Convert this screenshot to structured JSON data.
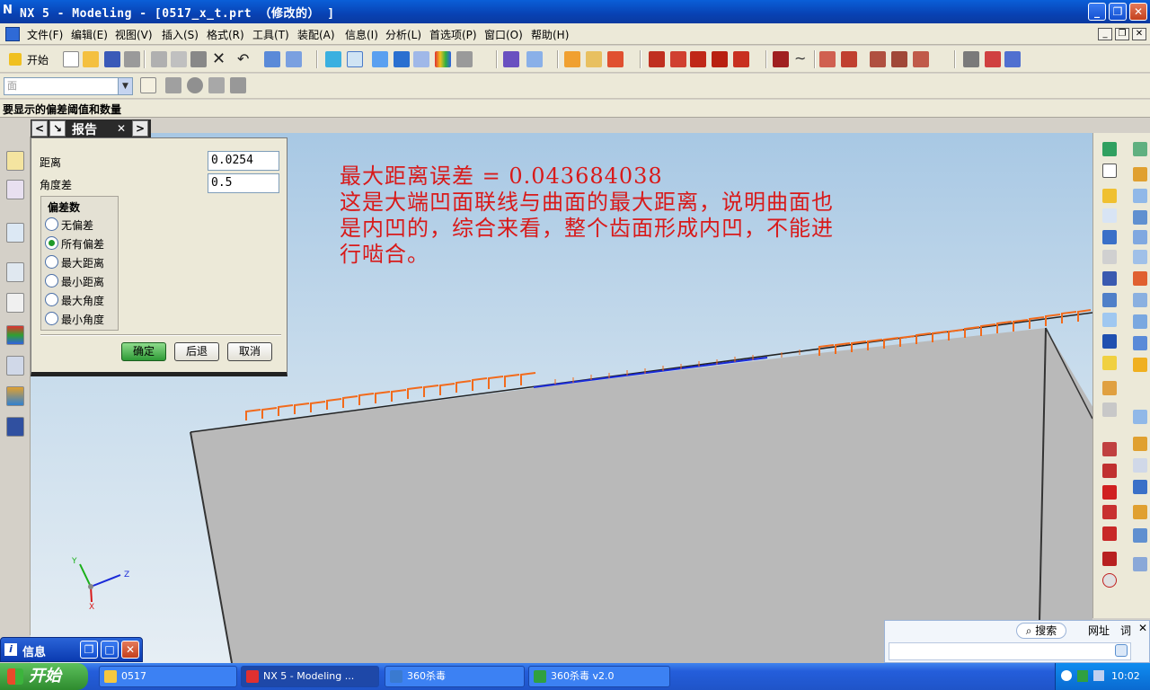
{
  "window": {
    "title": "NX 5 - Modeling - [0517_x_t.prt （修改的） ]",
    "minimize": "_",
    "restore": "❐",
    "close": "✕"
  },
  "menu": {
    "items": [
      "文件(F)",
      "编辑(E)",
      "视图(V)",
      "插入(S)",
      "格式(R)",
      "工具(T)",
      "装配(A)",
      "信息(I)",
      "分析(L)",
      "首选项(P)",
      "窗口(O)",
      "帮助(H)"
    ]
  },
  "toolbar": {
    "start_label": "开始",
    "filter_placeholder": "面"
  },
  "status": {
    "prompt": "要显示的偏差阈值和数量"
  },
  "dialog": {
    "title": "报告",
    "nav_prev": "<",
    "nav_next": ">",
    "close": "✕",
    "distance_label": "距离",
    "distance_value": "0.0254",
    "angle_label": "角度差",
    "angle_value": "0.5",
    "group_title": "偏差数",
    "options": [
      "无偏差",
      "所有偏差",
      "最大距离",
      "最小距离",
      "最大角度",
      "最小角度"
    ],
    "selected_option": "所有偏差",
    "ok": "确定",
    "back": "后退",
    "cancel": "取消"
  },
  "annotation": {
    "line1": "最大距离误差 = 0.043684038",
    "line2": "这是大端凹面联线与曲面的最大距离，说明曲面也",
    "line3": "是内凹的，综合来看，整个齿面形成内凹，不能进",
    "line4": "行啮合。"
  },
  "axes": {
    "x": "X",
    "y": "Y",
    "z": "Z"
  },
  "info_window": {
    "title": "信息"
  },
  "search_widget": {
    "search_label": "搜索",
    "url_label": "网址",
    "word_label": "词"
  },
  "taskbar": {
    "start": "开始",
    "tasks": [
      "0517",
      "NX 5 - Modeling ...",
      "360杀毒",
      "360杀毒 v2.0"
    ],
    "clock": "10:02"
  },
  "colors": {
    "accent_orange": "#f26a1b",
    "annotation_red": "#d81a1a",
    "deviation_blue": "#1a2ad8"
  }
}
